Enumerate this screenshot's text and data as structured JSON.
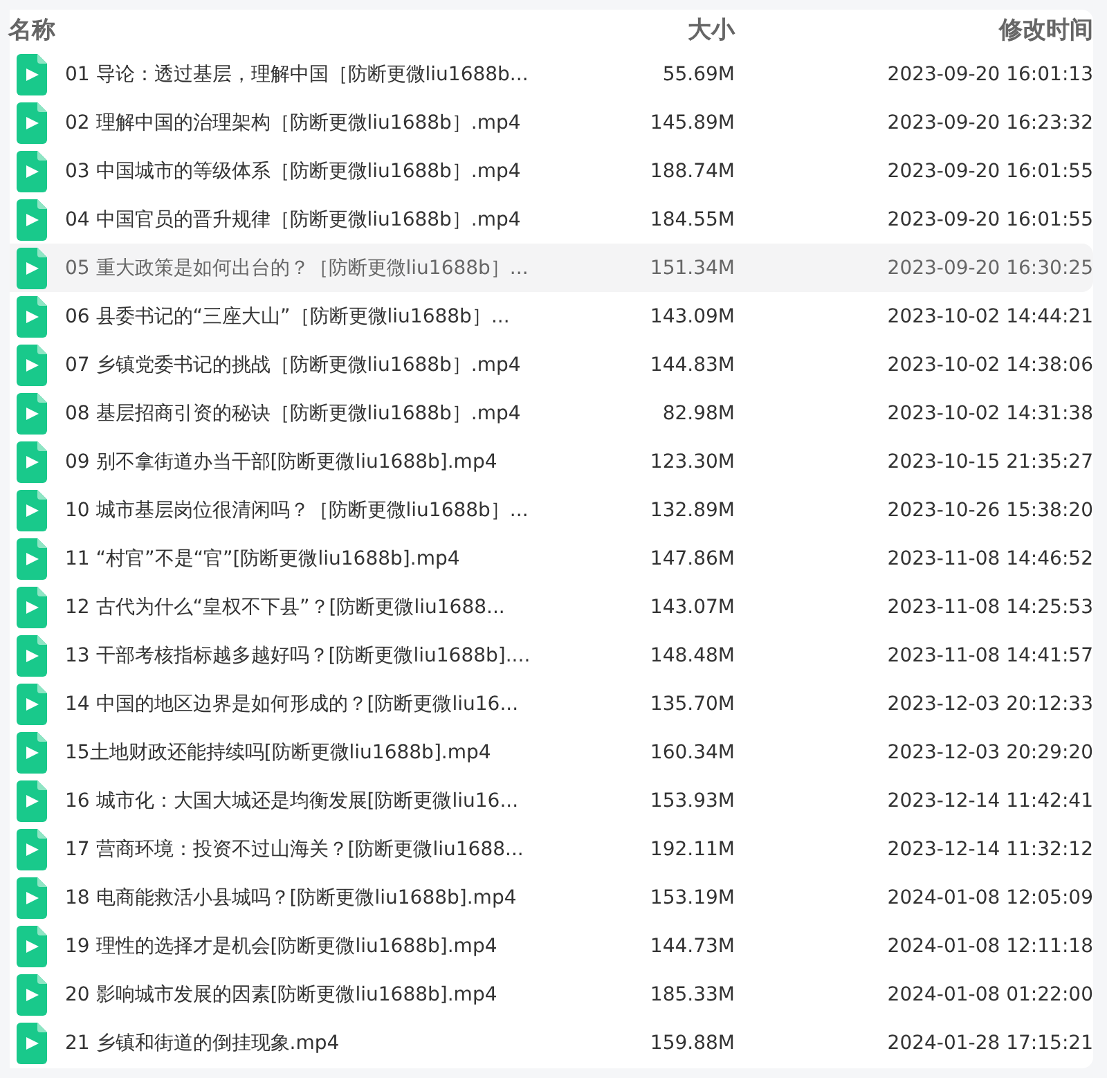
{
  "columns": [
    {
      "label": "名称"
    },
    {
      "label": "大小"
    },
    {
      "label": "修改时间"
    }
  ],
  "files": [
    {
      "name": "01 导论：透过基层，理解中国［防断更微liu1688b...",
      "size": "55.69M",
      "modified": "2023-09-20 16:01:13",
      "highlighted": false
    },
    {
      "name": "02 理解中国的治理架构［防断更微liu1688b］.mp4",
      "size": "145.89M",
      "modified": "2023-09-20 16:23:32",
      "highlighted": false
    },
    {
      "name": "03 中国城市的等级体系［防断更微liu1688b］.mp4",
      "size": "188.74M",
      "modified": "2023-09-20 16:01:55",
      "highlighted": false
    },
    {
      "name": "04 中国官员的晋升规律［防断更微liu1688b］.mp4",
      "size": "184.55M",
      "modified": "2023-09-20 16:01:55",
      "highlighted": false
    },
    {
      "name": "05 重大政策是如何出台的？［防断更微liu1688b］...",
      "size": "151.34M",
      "modified": "2023-09-20 16:30:25",
      "highlighted": true
    },
    {
      "name": "06 县委书记的“三座大山”［防断更微liu1688b］...",
      "size": "143.09M",
      "modified": "2023-10-02 14:44:21",
      "highlighted": false
    },
    {
      "name": "07 乡镇党委书记的挑战［防断更微liu1688b］.mp4",
      "size": "144.83M",
      "modified": "2023-10-02 14:38:06",
      "highlighted": false
    },
    {
      "name": "08 基层招商引资的秘诀［防断更微liu1688b］.mp4",
      "size": "82.98M",
      "modified": "2023-10-02 14:31:38",
      "highlighted": false
    },
    {
      "name": "09 别不拿街道办当干部[防断更微liu1688b].mp4",
      "size": "123.30M",
      "modified": "2023-10-15 21:35:27",
      "highlighted": false
    },
    {
      "name": "10 城市基层岗位很清闲吗？［防断更微liu1688b］...",
      "size": "132.89M",
      "modified": "2023-10-26 15:38:20",
      "highlighted": false
    },
    {
      "name": "11 “村官”不是“官”[防断更微liu1688b].mp4",
      "size": "147.86M",
      "modified": "2023-11-08 14:46:52",
      "highlighted": false
    },
    {
      "name": "12 古代为什么“皇权不下县”？[防断更微liu1688...",
      "size": "143.07M",
      "modified": "2023-11-08 14:25:53",
      "highlighted": false
    },
    {
      "name": "13 干部考核指标越多越好吗？[防断更微liu1688b]....",
      "size": "148.48M",
      "modified": "2023-11-08 14:41:57",
      "highlighted": false
    },
    {
      "name": "14 中国的地区边界是如何形成的？[防断更微liu16...",
      "size": "135.70M",
      "modified": "2023-12-03 20:12:33",
      "highlighted": false
    },
    {
      "name": "15土地财政还能持续吗[防断更微liu1688b].mp4",
      "size": "160.34M",
      "modified": "2023-12-03 20:29:20",
      "highlighted": false
    },
    {
      "name": "16 城市化：大国大城还是均衡发展[防断更微liu16...",
      "size": "153.93M",
      "modified": "2023-12-14 11:42:41",
      "highlighted": false
    },
    {
      "name": "17 营商环境：投资不过山海关？[防断更微liu1688...",
      "size": "192.11M",
      "modified": "2023-12-14 11:32:12",
      "highlighted": false
    },
    {
      "name": "18 电商能救活小县城吗？[防断更微liu1688b].mp4",
      "size": "153.19M",
      "modified": "2024-01-08 12:05:09",
      "highlighted": false
    },
    {
      "name": "19 理性的选择才是机会[防断更微liu1688b].mp4",
      "size": "144.73M",
      "modified": "2024-01-08 12:11:18",
      "highlighted": false
    },
    {
      "name": "20 影响城市发展的因素[防断更微liu1688b].mp4",
      "size": "185.33M",
      "modified": "2024-01-08 01:22:00",
      "highlighted": false
    },
    {
      "name": "21 乡镇和街道的倒挂现象.mp4",
      "size": "159.88M",
      "modified": "2024-01-28 17:15:21",
      "highlighted": false
    }
  ]
}
